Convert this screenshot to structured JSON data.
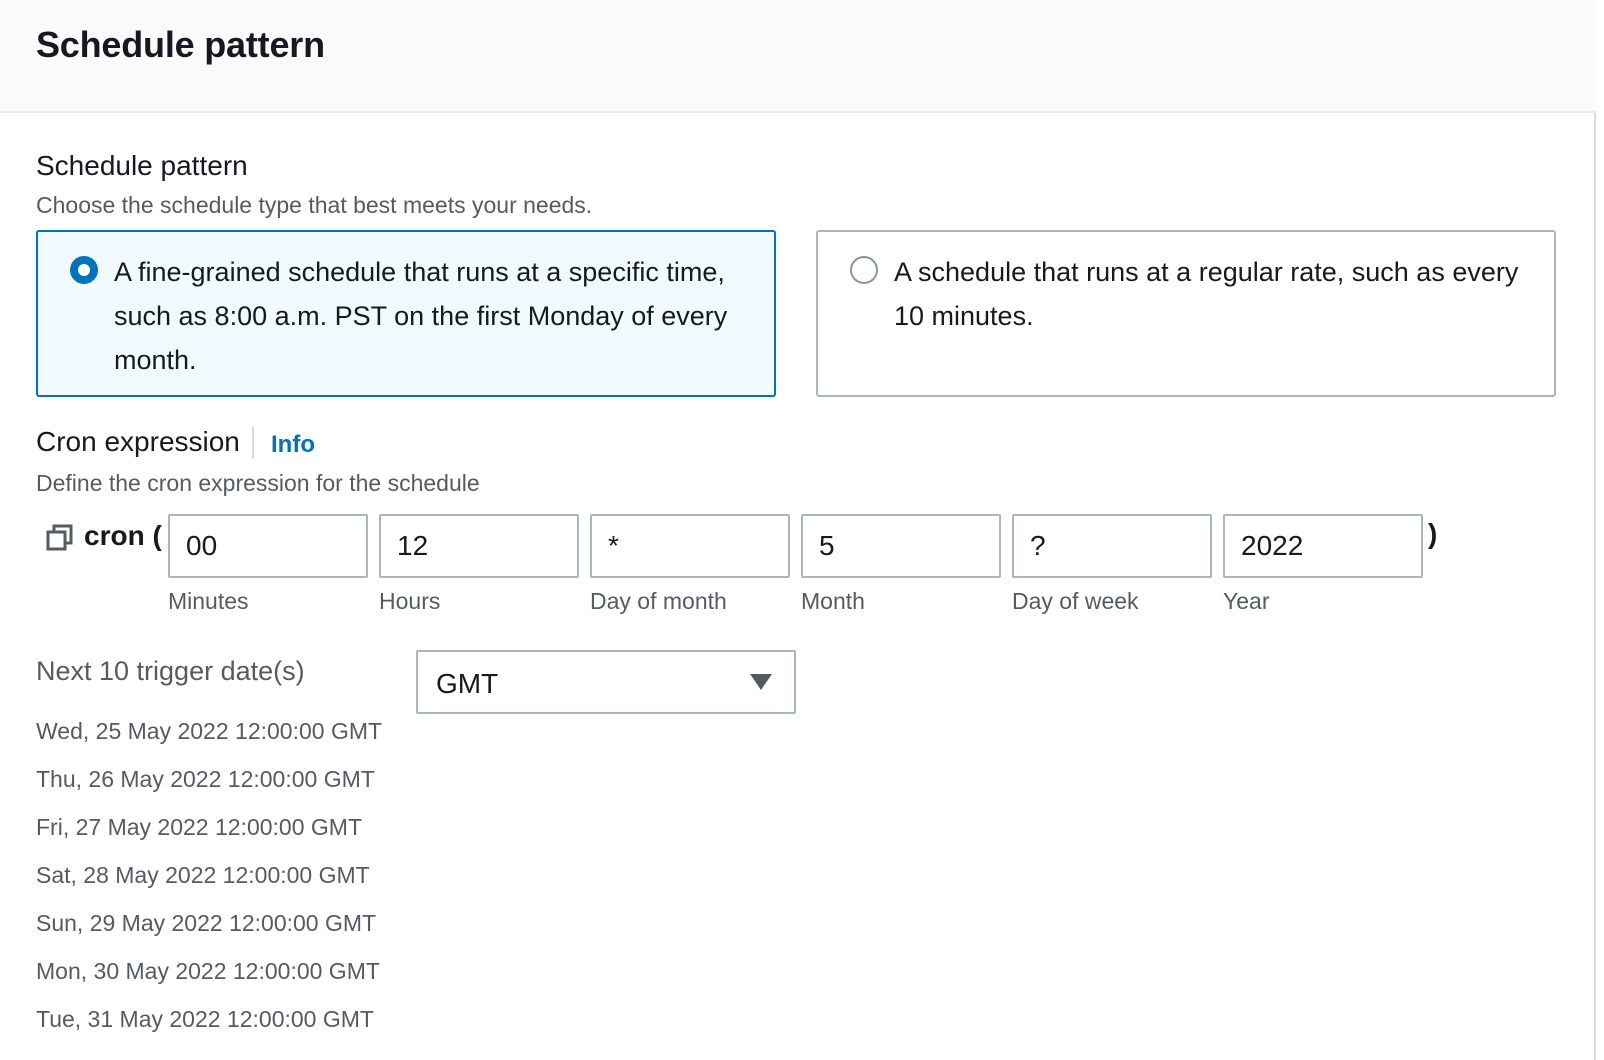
{
  "panel": {
    "title": "Schedule pattern"
  },
  "schedule_pattern": {
    "label": "Schedule pattern",
    "description": "Choose the schedule type that best meets your needs.",
    "options": [
      {
        "text": "A fine-grained schedule that runs at a specific time, such as 8:00 a.m. PST on the first Monday of every month.",
        "selected": true
      },
      {
        "text": "A schedule that runs at a regular rate, such as every 10 minutes.",
        "selected": false
      }
    ]
  },
  "cron": {
    "label": "Cron expression",
    "info_link": "Info",
    "description": "Define the cron expression for the schedule",
    "copy_icon": "copy-icon",
    "prefix": "cron (",
    "suffix": ")",
    "fields": [
      {
        "label": "Minutes",
        "value": "00"
      },
      {
        "label": "Hours",
        "value": "12"
      },
      {
        "label": "Day of month",
        "value": "*"
      },
      {
        "label": "Month",
        "value": "5"
      },
      {
        "label": "Day of week",
        "value": "?"
      },
      {
        "label": "Year",
        "value": "2022"
      }
    ]
  },
  "trigger_dates": {
    "label": "Next 10 trigger date(s)",
    "timezone": "GMT",
    "dropdown_icon": "caret-down-icon",
    "dates": [
      "Wed, 25 May 2022 12:00:00 GMT",
      "Thu, 26 May 2022 12:00:00 GMT",
      "Fri, 27 May 2022 12:00:00 GMT",
      "Sat, 28 May 2022 12:00:00 GMT",
      "Sun, 29 May 2022 12:00:00 GMT",
      "Mon, 30 May 2022 12:00:00 GMT",
      "Tue, 31 May 2022 12:00:00 GMT"
    ]
  },
  "colors": {
    "accent": "#0073bb",
    "selected_background": "#f1faff",
    "border": "#aab7b8",
    "secondary_text": "#545b64"
  }
}
